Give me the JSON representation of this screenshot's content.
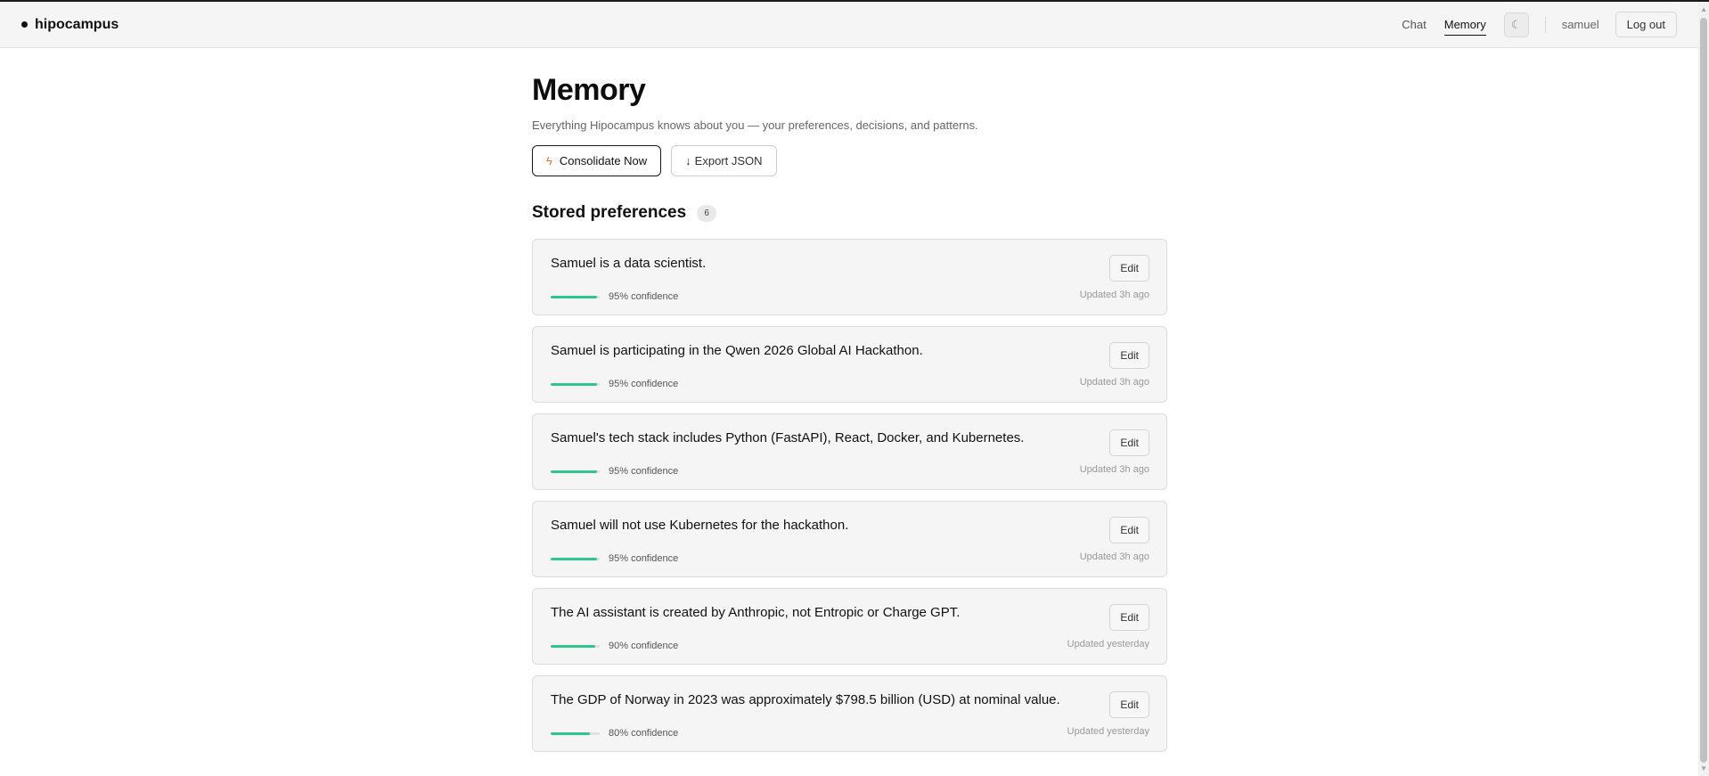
{
  "header": {
    "brand": "hipocampus",
    "nav": [
      {
        "label": "Chat",
        "active": false
      },
      {
        "label": "Memory",
        "active": true
      }
    ],
    "theme_icon": "moon-icon",
    "username": "samuel",
    "logout_label": "Log out"
  },
  "page": {
    "title": "Memory",
    "subtitle": "Everything Hipocampus knows about you — your preferences, decisions, and patterns.",
    "consolidate_label": "Consolidate Now",
    "consolidate_icon": "bolt-icon",
    "export_label": "Export JSON",
    "export_icon": "arrow-down-icon"
  },
  "section": {
    "title": "Stored preferences",
    "count": "6",
    "edit_label": "Edit"
  },
  "preferences": [
    {
      "text": "Samuel is a data scientist.",
      "confidence": 95,
      "confidence_label": "95% confidence",
      "updated": "Updated 3h ago"
    },
    {
      "text": "Samuel is participating in the Qwen 2026 Global AI Hackathon.",
      "confidence": 95,
      "confidence_label": "95% confidence",
      "updated": "Updated 3h ago"
    },
    {
      "text": "Samuel's tech stack includes Python (FastAPI), React, Docker, and Kubernetes.",
      "confidence": 95,
      "confidence_label": "95% confidence",
      "updated": "Updated 3h ago"
    },
    {
      "text": "Samuel will not use Kubernetes for the hackathon.",
      "confidence": 95,
      "confidence_label": "95% confidence",
      "updated": "Updated 3h ago"
    },
    {
      "text": "The AI assistant is created by Anthropic, not Entropic or Charge GPT.",
      "confidence": 90,
      "confidence_label": "90% confidence",
      "updated": "Updated yesterday"
    },
    {
      "text": "The GDP of Norway in 2023 was approximately $798.5 billion (USD) at nominal value.",
      "confidence": 80,
      "confidence_label": "80% confidence",
      "updated": "Updated yesterday"
    }
  ],
  "colors": {
    "accent_bar": "#2ec690",
    "bolt": "#e8703a"
  }
}
